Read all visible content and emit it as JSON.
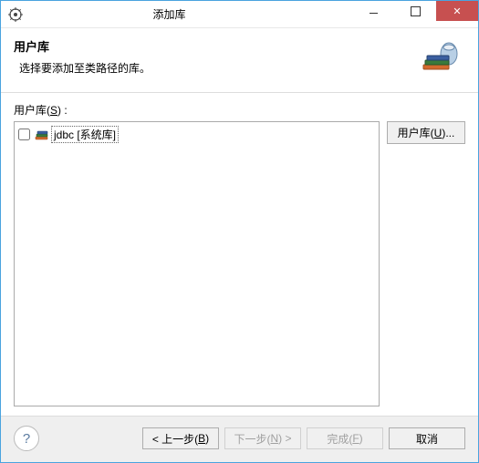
{
  "window": {
    "title": "添加库"
  },
  "banner": {
    "title": "用户库",
    "subtitle": "选择要添加至类路径的库。"
  },
  "content": {
    "list_label_prefix": "用户库(",
    "list_label_key": "S",
    "list_label_suffix": ") :",
    "items": [
      {
        "checked": false,
        "label": "jdbc [系统库]"
      }
    ]
  },
  "side": {
    "user_lib_btn_prefix": "用户库(",
    "user_lib_btn_key": "U",
    "user_lib_btn_suffix": ")..."
  },
  "footer": {
    "back_prefix": "< 上一步(",
    "back_key": "B",
    "back_suffix": ")",
    "next_prefix": "下一步(",
    "next_key": "N",
    "next_suffix": ") >",
    "finish_prefix": "完成(",
    "finish_key": "F",
    "finish_suffix": ")",
    "cancel": "取消"
  }
}
